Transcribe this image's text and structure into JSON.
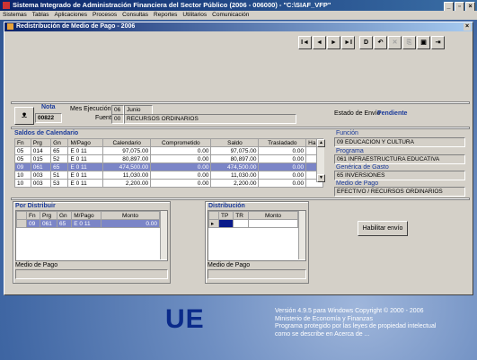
{
  "app": {
    "title": "Sistema Integrado de Administración Financiera del Sector Público (2006 - 006000) - \"C:\\SIAF_VFP\""
  },
  "menu": [
    "Sistemas",
    "Tablas",
    "Aplicaciones",
    "Procesos",
    "Consultas",
    "Reportes",
    "Utilitarios",
    "Comunicación"
  ],
  "window": {
    "title": "Redistribución de Medio de Pago - 2006"
  },
  "nav": {
    "first": "I◄",
    "prev": "◄",
    "next": "►",
    "last": "►I",
    "new": "D",
    "undo": "↶",
    "delete": "✕",
    "edit": "⎘",
    "save": "▣",
    "exit": "⇥"
  },
  "header": {
    "nota_label": "Nota",
    "nota_value": "00822",
    "mes_label": "Mes Ejecución",
    "mes_code": "06",
    "mes_name": "Junio",
    "fuente_label": "Fuente",
    "fuente_code": "00",
    "fuente_name": "RECURSOS ORDINARIOS",
    "estado_label": "Estado de Envío",
    "estado_value": "Pendiente"
  },
  "saldos": {
    "title": "Saldos de Calendario",
    "columns": [
      "Fn",
      "Prg",
      "Gn",
      "M/Pago",
      "Calendario",
      "Comprometido",
      "Saldo",
      "Trasladado",
      "Ha"
    ],
    "rows": [
      [
        "05",
        "014",
        "65",
        "E 0 11",
        "97,075.00",
        "0.00",
        "97,075.00",
        "0.00",
        ""
      ],
      [
        "05",
        "015",
        "52",
        "E 0 11",
        "80,897.00",
        "0.00",
        "80,897.00",
        "0.00",
        ""
      ],
      [
        "09",
        "061",
        "65",
        "E 0 11",
        "474,500.00",
        "0.00",
        "474,500.00",
        "0.00",
        ""
      ],
      [
        "10",
        "003",
        "51",
        "E 0 11",
        "11,030.00",
        "0.00",
        "11,030.00",
        "0.00",
        ""
      ],
      [
        "10",
        "003",
        "53",
        "E 0 11",
        "2,200.00",
        "0.00",
        "2,200.00",
        "0.00",
        ""
      ]
    ]
  },
  "info": {
    "funcion_label": "Función",
    "funcion_value": "09 EDUCACION Y CULTURA",
    "programa_label": "Programa",
    "programa_value": "061 INFRAESTRUCTURA EDUCATIVA",
    "generica_label": "Genérica de Gasto",
    "generica_value": "65 INVERSIONES",
    "medio_label": "Medio de Pago",
    "medio_value": "EFECTIVO / RECURSOS ORDINARIOS"
  },
  "por_distribuir": {
    "title": "Por Distribuir",
    "columns": [
      "Fn",
      "Prg",
      "Gn",
      "M/Pago",
      "Monto"
    ],
    "row": [
      "09",
      "061",
      "65",
      "E 0 11",
      "0.00"
    ],
    "medio_label": "Medio de Pago"
  },
  "distribucion": {
    "title": "Distribución",
    "columns": [
      "TP",
      "TR",
      "Monto"
    ],
    "medio_label": "Medio de Pago"
  },
  "habilitar_button": "Habilitar envío",
  "footer": {
    "logo": "UE",
    "lines": [
      "Versión 4.9.5 para Windows Copyright © 2000 - 2006",
      "Ministerio de Economía y Finanzas",
      "Programa protegido por las leyes de propiedad intelectual",
      "como se describe en Acerca de ..."
    ]
  }
}
